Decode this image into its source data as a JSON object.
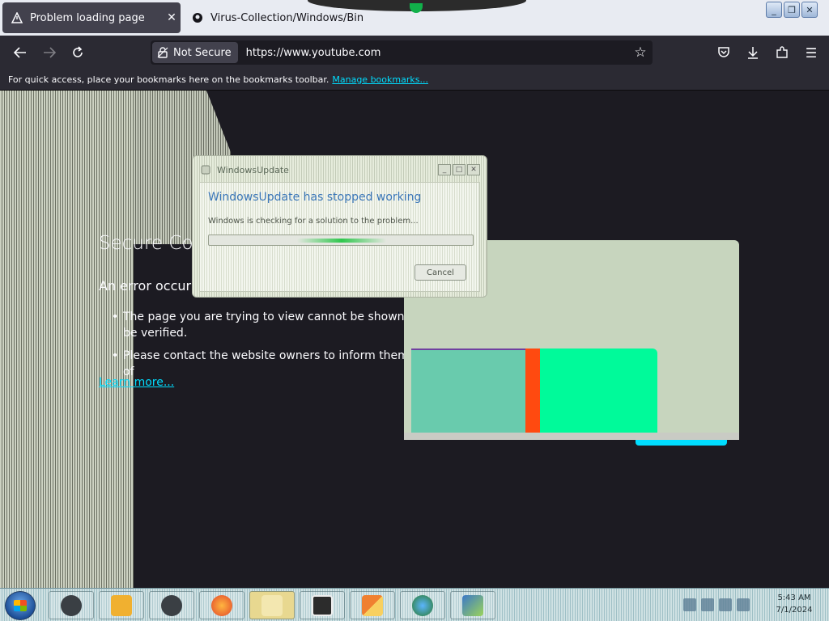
{
  "tabs": [
    {
      "title": "Problem loading page",
      "active": true
    },
    {
      "title": "Virus-Collection/Windows/Bin",
      "active": false
    }
  ],
  "nav": {
    "not_secure": "Not Secure",
    "url": "https://www.youtube.com"
  },
  "bookmarks": {
    "text": "For quick access, place your bookmarks here on the bookmarks toolbar.",
    "link": "Manage bookmarks..."
  },
  "error_page": {
    "title": "Secure Co",
    "subtitle": "An error occurr",
    "bullets": [
      "The page you are trying to view cannot be shown be verified.",
      "Please contact the website owners to inform them of"
    ],
    "learn_more": "Learn more..."
  },
  "dialog": {
    "title": "WindowsUpdate",
    "heading": "WindowsUpdate has stopped working",
    "message": "Windows is checking for a solution to the problem...",
    "cancel": "Cancel",
    "progress": 0.5
  },
  "clock": {
    "time": "5:43 AM",
    "date": "7/1/2024"
  },
  "colors": {
    "accent": "#00ddff",
    "glitch_teal": "#69cbad",
    "glitch_red": "#ff4a10",
    "glitch_green": "#00fa9a"
  }
}
